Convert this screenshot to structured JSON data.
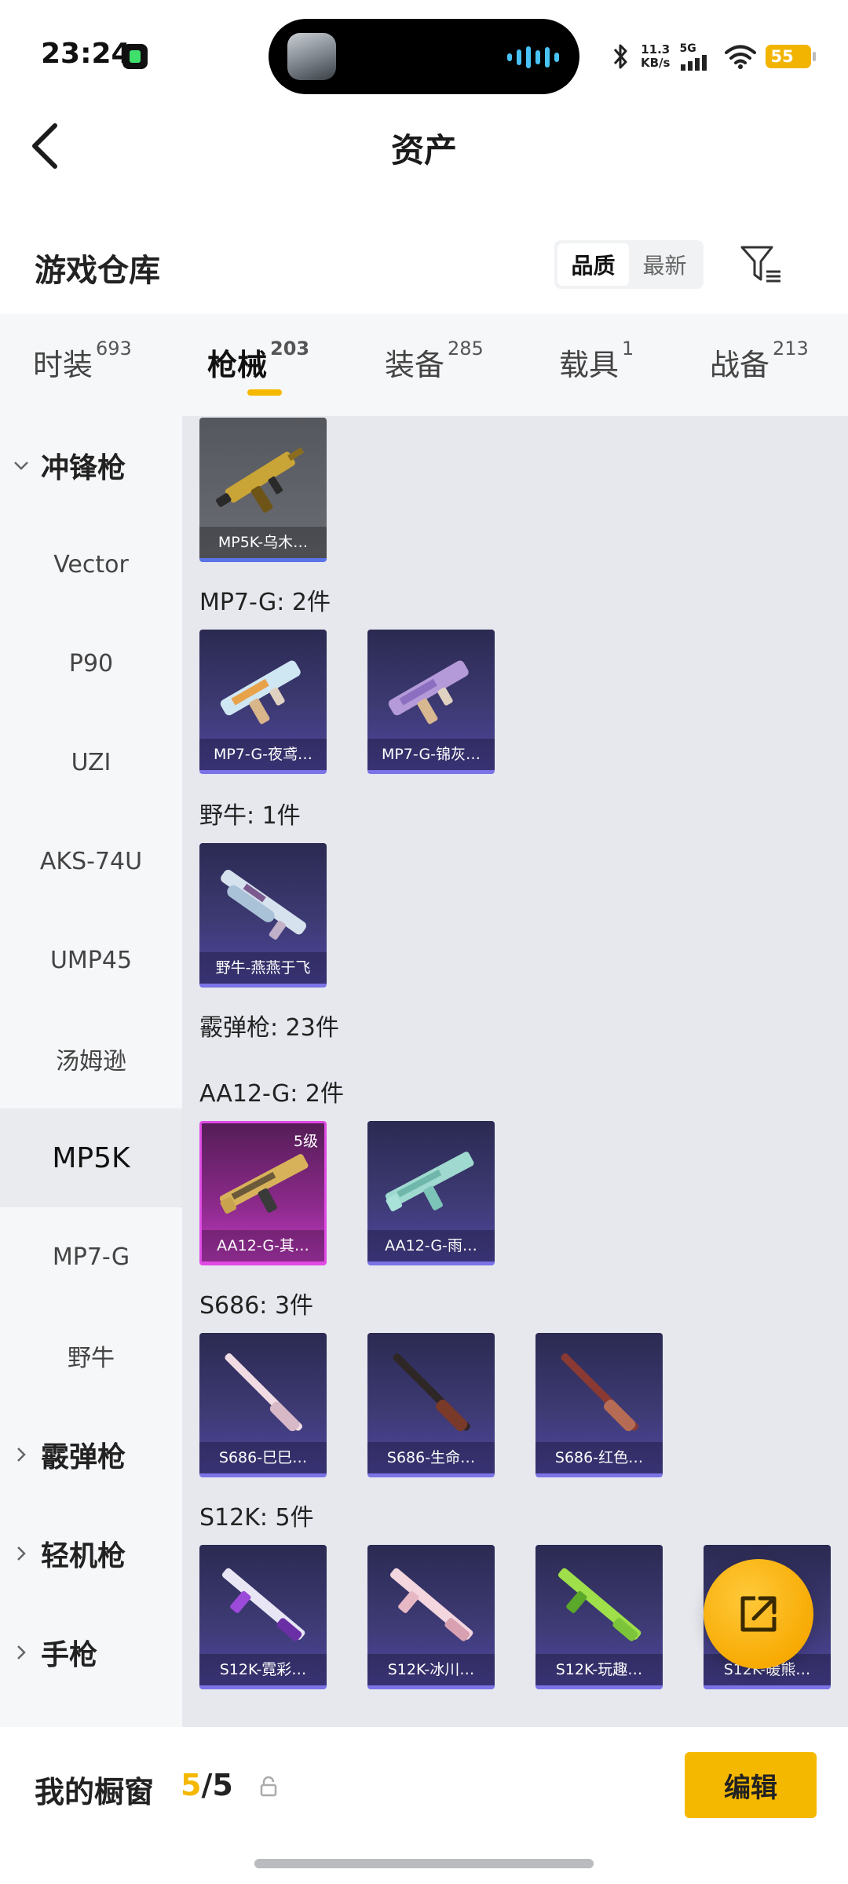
{
  "status_bar": {
    "time": "23:24",
    "speed_value": "11.3",
    "speed_unit": "KB/s",
    "network": "5G",
    "battery": "55"
  },
  "header": {
    "title": "资产"
  },
  "section": {
    "title": "游戏仓库"
  },
  "sort": {
    "options": [
      "品质",
      "最新"
    ],
    "active": "品质"
  },
  "tabs": [
    {
      "label": "时装",
      "count": "693"
    },
    {
      "label": "枪械",
      "count": "203",
      "active": true
    },
    {
      "label": "装备",
      "count": "285"
    },
    {
      "label": "载具",
      "count": "1"
    },
    {
      "label": "战备",
      "count": "213"
    }
  ],
  "sidebar": [
    {
      "label": "冲锋枪",
      "type": "group",
      "expanded": true
    },
    {
      "label": "Vector"
    },
    {
      "label": "P90"
    },
    {
      "label": "UZI"
    },
    {
      "label": "AKS-74U"
    },
    {
      "label": "UMP45"
    },
    {
      "label": "汤姆逊"
    },
    {
      "label": "MP5K",
      "active": true
    },
    {
      "label": "MP7-G"
    },
    {
      "label": "野牛"
    },
    {
      "label": "霰弹枪",
      "type": "group"
    },
    {
      "label": "轻机枪",
      "type": "group"
    },
    {
      "label": "手枪",
      "type": "group"
    }
  ],
  "content": {
    "top_card": {
      "label": "MP5K-乌木…"
    },
    "groups": [
      {
        "title": "MP7-G: 2件",
        "items": [
          "MP7-G-夜鸢…",
          "MP7-G-锦灰…"
        ]
      },
      {
        "title": "野牛: 1件",
        "items": [
          "野牛-燕燕于飞"
        ]
      },
      {
        "title": "霰弹枪: 23件"
      },
      {
        "title": "AA12-G: 2件",
        "items": [
          "AA12-G-其…",
          "AA12-G-雨…"
        ],
        "level_badge": "5级"
      },
      {
        "title": "S686: 3件",
        "items": [
          "S686-巳巳…",
          "S686-生命…",
          "S686-红色…"
        ]
      },
      {
        "title": "S12K: 5件",
        "items": [
          "S12K-霓彩…",
          "S12K-冰川…",
          "S12K-玩趣…",
          "S12K-暖熊…"
        ]
      }
    ]
  },
  "bottom": {
    "title": "我的橱窗",
    "count_current": "5",
    "count_sep": "/",
    "count_total": "5",
    "edit_label": "编辑"
  },
  "colors": {
    "accent": "#f5b800",
    "card_purple": "#3d3a73",
    "card_pink": "#c03bc2"
  },
  "icons": [
    "back-icon",
    "filter-icon",
    "chevron-down-icon",
    "chevron-right-icon",
    "share-icon",
    "lock-icon",
    "bluetooth-icon",
    "wifi-icon"
  ]
}
